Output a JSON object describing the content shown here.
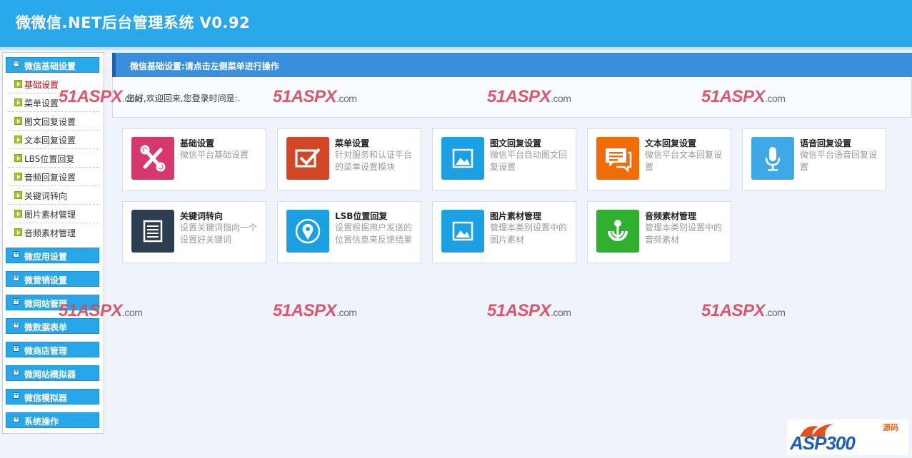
{
  "app": {
    "title": "微微信.NET后台管理系统 V0.92"
  },
  "sidebar": {
    "open_section": {
      "label": "微信基础设置",
      "items": [
        {
          "label": "基础设置",
          "active": true
        },
        {
          "label": "菜单设置"
        },
        {
          "label": "图文回复设置"
        },
        {
          "label": "文本回复设置"
        },
        {
          "label": "LBS位置回复"
        },
        {
          "label": "音频回复设置"
        },
        {
          "label": "关键词转向"
        },
        {
          "label": "图片素材管理"
        },
        {
          "label": "音频素材管理"
        }
      ]
    },
    "sections": [
      {
        "label": "微应用设置"
      },
      {
        "label": "微营销设置"
      },
      {
        "label": "微网站管理"
      },
      {
        "label": "微数据表单"
      },
      {
        "label": "微商店管理"
      },
      {
        "label": "微网站模拟器"
      },
      {
        "label": "微信模拟器"
      },
      {
        "label": "系统操作"
      }
    ]
  },
  "main": {
    "header": "微信基础设置:请点击左侧菜单进行操作",
    "welcome": "您好,欢迎回来,您登录时间是:.",
    "cards": [
      {
        "title": "基础设置",
        "desc": "微信平台基础设置",
        "icon": "tools-icon",
        "color": "#d6386e"
      },
      {
        "title": "菜单设置",
        "desc": "针对服务和认证平台的菜单设置模块",
        "icon": "checkbox-icon",
        "color": "#d24726"
      },
      {
        "title": "图文回复设置",
        "desc": "微信平台自动图文回复设置",
        "icon": "picture-icon",
        "color": "#1ba1e2"
      },
      {
        "title": "文本回复设置",
        "desc": "微信平台文本回复设置",
        "icon": "chat-icon",
        "color": "#f26c05"
      },
      {
        "title": "语音回复设置",
        "desc": "微信平台语音回复设置",
        "icon": "microphone-icon",
        "color": "#3fa9e8"
      },
      {
        "title": "关键词转向",
        "desc": "设置关键词指向一个设置好关键词",
        "icon": "document-icon",
        "color": "#2c3e50"
      },
      {
        "title": "LSB位置回复",
        "desc": "设置根据用户发送的位置信息来反馈结果",
        "icon": "location-pin-icon",
        "color": "#1ba1e2"
      },
      {
        "title": "图片素材管理",
        "desc": "管理本类别设置中的图片素材",
        "icon": "picture-icon",
        "color": "#1ba1e2"
      },
      {
        "title": "音频素材管理",
        "desc": "管理本类别设置中的音频素材",
        "icon": "wikimedia-icon",
        "color": "#2fb12f"
      }
    ]
  },
  "watermark": {
    "brand": "51ASPX",
    "domain": ".com"
  },
  "logo": {
    "brand": "ASP300",
    "cn": "源码"
  }
}
